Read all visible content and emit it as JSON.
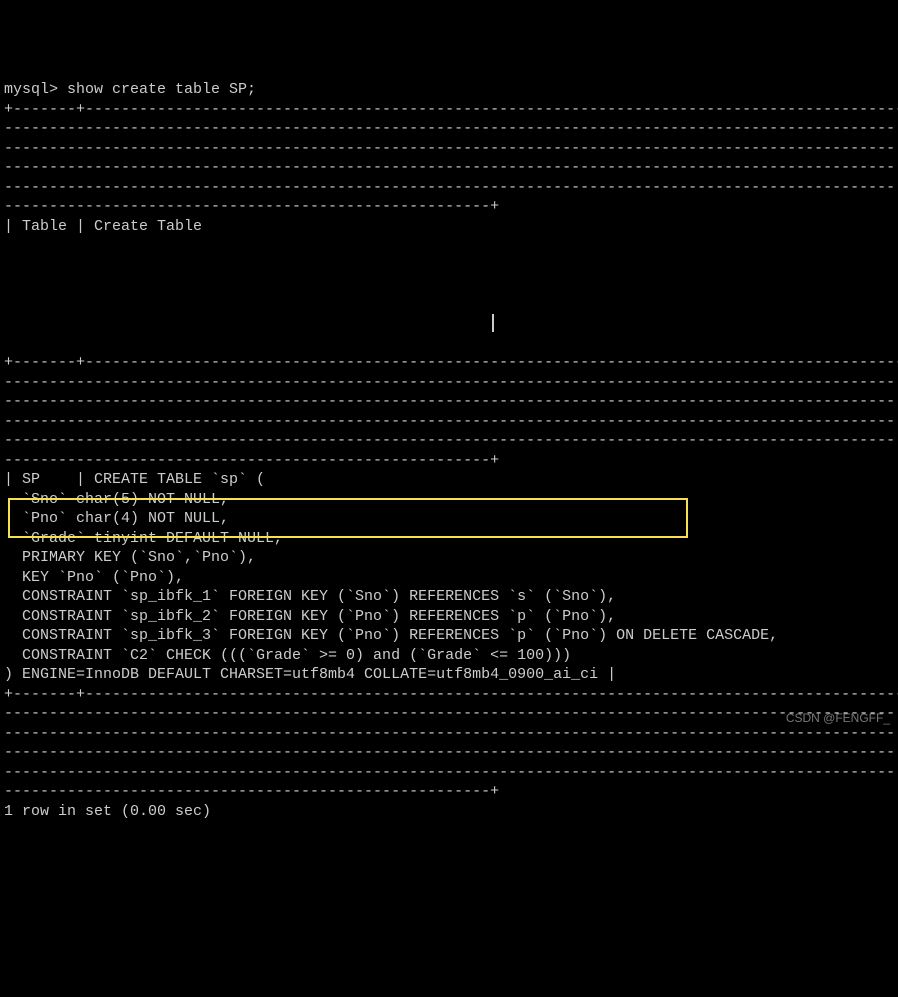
{
  "prompt": "mysql>",
  "command": " show create table SP;",
  "border_top1": "+-------+-----------------------------------------------------------------------------------------------",
  "border_line_full": "---------------------------------------------------------------------------------------------------",
  "border_line_end": "------------------------------------------------------+",
  "header_row": "| Table | Create Table",
  "border_mid": "+-------+-----------------------------------------------------------------------------------------------",
  "table_name": "| SP    | CREATE TABLE `sp` (",
  "col1": "  `Sno` char(5) NOT NULL,",
  "col2": "  `Pno` char(4) NOT NULL,",
  "col3": "  `Grade` tinyint DEFAULT NULL,",
  "pk": "  PRIMARY KEY (`Sno`,`Pno`),",
  "key1": "  KEY `Pno` (`Pno`),",
  "constraint1": "  CONSTRAINT `sp_ibfk_1` FOREIGN KEY (`Sno`) REFERENCES `s` (`Sno`),",
  "constraint2": "  CONSTRAINT `sp_ibfk_2` FOREIGN KEY (`Pno`) REFERENCES `p` (`Pno`),",
  "constraint3": "  CONSTRAINT `sp_ibfk_3` FOREIGN KEY (`Pno`) REFERENCES `p` (`Pno`) ON DELETE CASCADE,",
  "constraint4": "  CONSTRAINT `C2` CHECK (((`Grade` >= 0) and (`Grade` <= 100)))",
  "engine": ") ENGINE=InnoDB DEFAULT CHARSET=utf8mb4 COLLATE=utf8mb4_0900_ai_ci |",
  "result": "1 row in set (0.00 sec)",
  "watermark": "CSDN @FENGFF_"
}
